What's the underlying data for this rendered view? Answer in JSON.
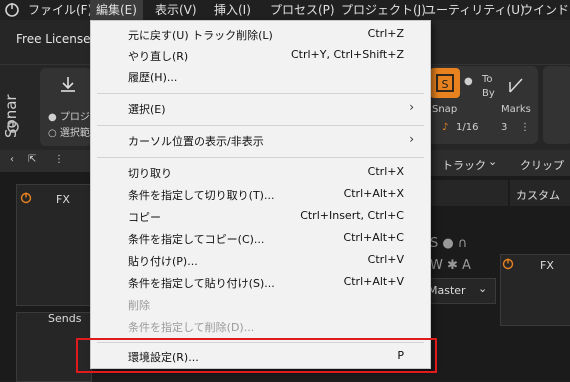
{
  "menubar": {
    "items": [
      {
        "label": "ファイル(F)"
      },
      {
        "label": "編集(E)"
      },
      {
        "label": "表示(V)"
      },
      {
        "label": "挿入(I)"
      },
      {
        "label": "プロセス(P)"
      },
      {
        "label": "プロジェクト(J)"
      },
      {
        "label": "ユーティリティ(U)"
      },
      {
        "label": "ウインドウ("
      }
    ]
  },
  "license": {
    "text": "Free License"
  },
  "sonar": {
    "logo": "Sonar"
  },
  "transport": {
    "option1": "プロジェ",
    "option2": "選択範"
  },
  "snap": {
    "label": "Snap",
    "to": "To",
    "by": "By",
    "value": "1/16",
    "marks_label": "Marks",
    "marks_value": "3"
  },
  "panels": {
    "fx_left": "FX",
    "fx_right": "FX",
    "sends": "Sends",
    "track_menu": "トラック",
    "clip_menu": "クリップ",
    "custom": "カスタム",
    "master": "Master"
  },
  "edit_menu": {
    "items": [
      {
        "label": "元に戻す(U) トラック削除(L)",
        "shortcut": "Ctrl+Z"
      },
      {
        "label": "やり直し(R)",
        "shortcut": "Ctrl+Y, Ctrl+Shift+Z"
      },
      {
        "label": "履歴(H)...",
        "shortcut": ""
      },
      {
        "label": "選択(E)",
        "shortcut": ""
      },
      {
        "label": "カーソル位置の表示/非表示",
        "shortcut": ""
      },
      {
        "label": "切り取り",
        "shortcut": "Ctrl+X"
      },
      {
        "label": "条件を指定して切り取り(T)...",
        "shortcut": "Ctrl+Alt+X"
      },
      {
        "label": "コピー",
        "shortcut": "Ctrl+Insert, Ctrl+C"
      },
      {
        "label": "条件を指定してコピー(C)...",
        "shortcut": "Ctrl+Alt+C"
      },
      {
        "label": "貼り付け(P)...",
        "shortcut": "Ctrl+V"
      },
      {
        "label": "条件を指定して貼り付け(S)...",
        "shortcut": "Ctrl+Alt+V"
      },
      {
        "label": "削除",
        "shortcut": ""
      },
      {
        "label": "条件を指定して削除(D)...",
        "shortcut": ""
      },
      {
        "label": "環境設定(R)...",
        "shortcut": "P"
      }
    ]
  },
  "colors": {
    "accent": "#e8821f",
    "highlight": "#e01b1b"
  }
}
